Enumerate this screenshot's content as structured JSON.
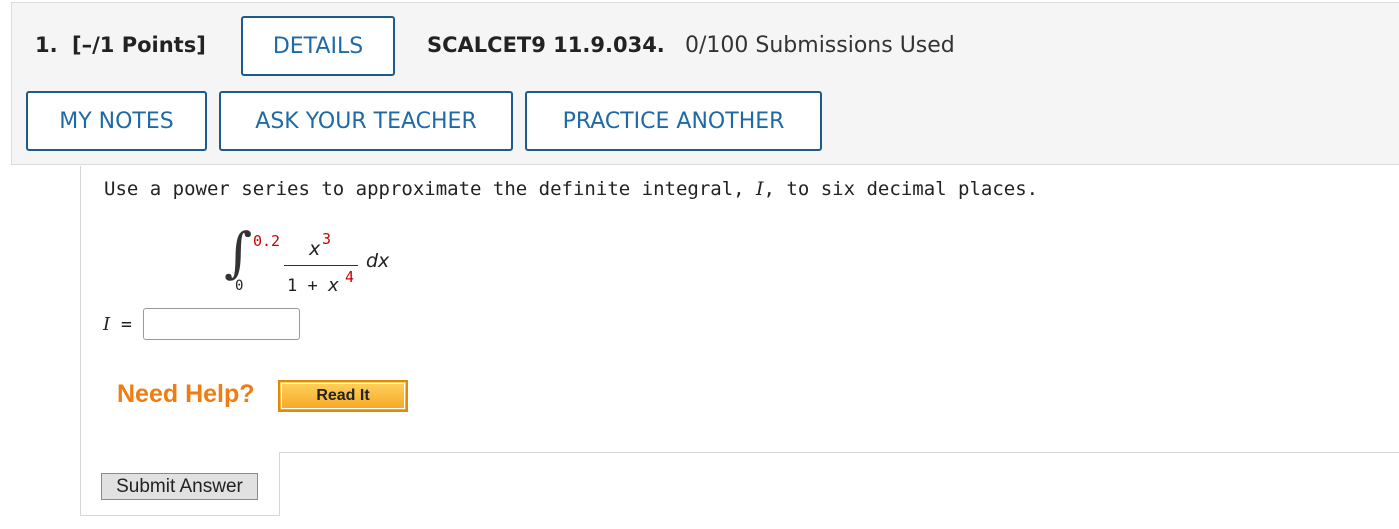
{
  "header": {
    "question_number": "1.",
    "points": "[–/1 Points]",
    "details_label": "DETAILS",
    "question_code": "SCALCET9 11.9.034.",
    "submissions": "0/100 Submissions Used",
    "my_notes_label": "MY NOTES",
    "ask_teacher_label": "ASK YOUR TEACHER",
    "practice_another_label": "PRACTICE ANOTHER"
  },
  "question": {
    "text_before": "Use a power series to approximate the definite integral, ",
    "variable": "I",
    "text_after": ", to six decimal places.",
    "integral": {
      "upper_limit": "0.2",
      "lower_limit": "0",
      "numerator_var": "x",
      "numerator_exp": "3",
      "denominator_prefix": "1 + ",
      "denominator_var": "x",
      "denominator_exp": "4",
      "differential": "dx"
    }
  },
  "answer": {
    "label_var": "I",
    "label_eq": " =",
    "value": "",
    "placeholder": ""
  },
  "help": {
    "need_help_label": "Need Help?",
    "read_it_label": "Read It"
  },
  "actions": {
    "submit_label": "Submit Answer"
  },
  "colors": {
    "button_text": "#1f6aa5",
    "button_border": "#1d5b8c",
    "highlight_red": "#cc0000",
    "need_help_orange": "#f07c12"
  }
}
